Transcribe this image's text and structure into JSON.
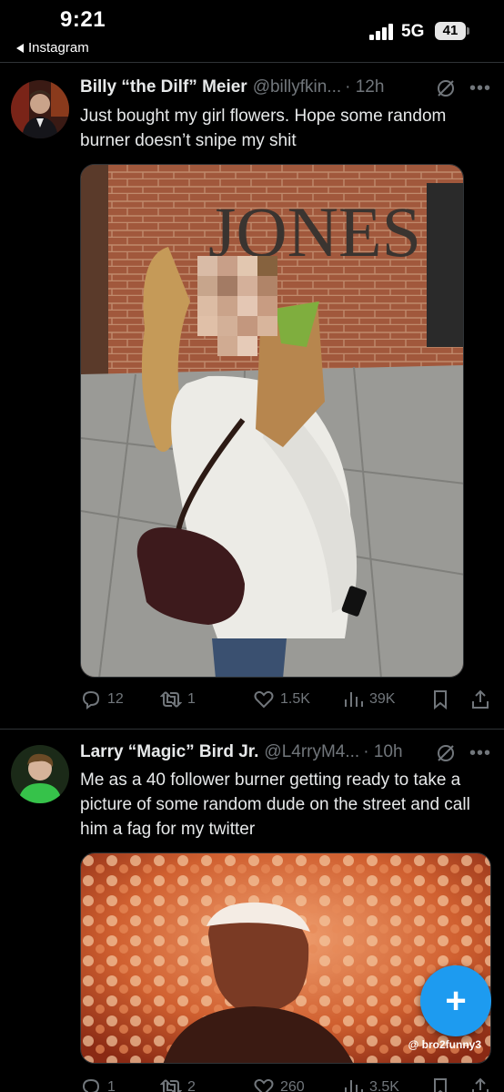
{
  "status_bar": {
    "time": "9:21",
    "back_app": "Instagram",
    "network": "5G",
    "battery": "41"
  },
  "tweets": [
    {
      "name": "Billy “the Dilf” Meier",
      "handle": "@billyfkin...",
      "time": "· 12h",
      "text": "Just bought my girl flowers. Hope some random burner doesn’t snipe my shit",
      "media_sign_text": "JONES",
      "replies": "12",
      "reposts": "1",
      "likes": "1.5K",
      "views": "39K"
    },
    {
      "name": "Larry “Magic” Bird Jr.",
      "handle": "@L4rryM4...",
      "time": "· 10h",
      "text": "Me as a 40 follower burner getting ready to take a picture of some random dude on the street and call him a fag for my twitter",
      "watermark": "@ bro2funny3",
      "replies": "1",
      "reposts": "2",
      "likes": "260",
      "views": "3.5K"
    }
  ],
  "colors": {
    "background": "#000000",
    "text": "#e7e9ea",
    "muted": "#71767b",
    "accent": "#1d9bf0",
    "divider": "#2f3336"
  },
  "icons": [
    "reply-icon",
    "repost-icon",
    "like-icon",
    "views-icon",
    "bookmark-icon",
    "share-icon",
    "grok-icon",
    "more-icon",
    "compose-icon"
  ]
}
